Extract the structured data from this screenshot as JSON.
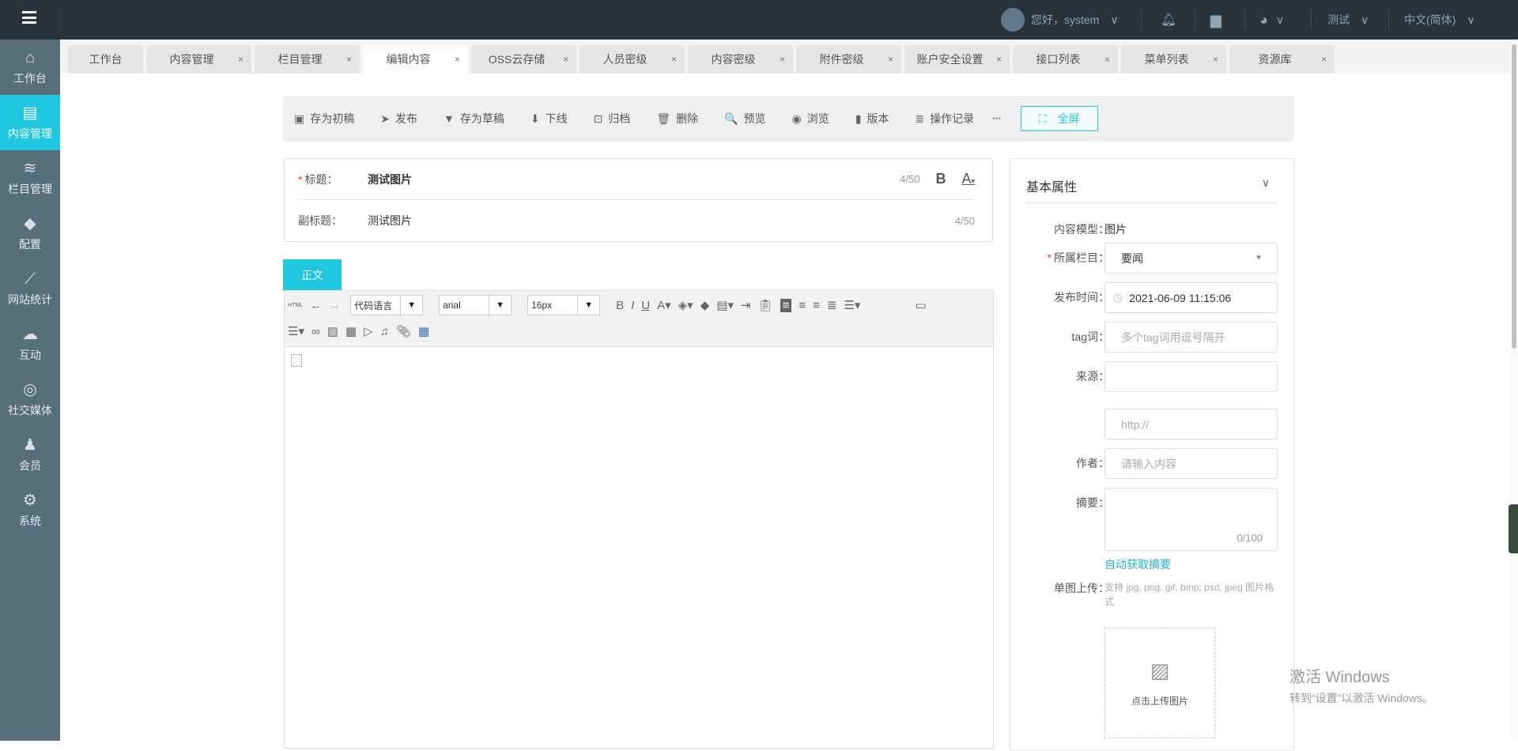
{
  "topbar": {
    "greeting": "您好，system",
    "site": "测试",
    "language": "中文(简体)"
  },
  "sidebar": [
    {
      "icon": "home-icon",
      "glyph": "⌂",
      "label": "工作台"
    },
    {
      "icon": "content-icon",
      "glyph": "▤",
      "label": "内容管理",
      "active": true
    },
    {
      "icon": "layers-icon",
      "glyph": "≋",
      "label": "栏目管理"
    },
    {
      "icon": "cube-icon",
      "glyph": "◆",
      "label": "配置"
    },
    {
      "icon": "chart-icon",
      "glyph": "⟋",
      "label": "网站统计"
    },
    {
      "icon": "chat-icon",
      "glyph": "☁",
      "label": "互动"
    },
    {
      "icon": "social-icon",
      "glyph": "◎",
      "label": "社交媒体"
    },
    {
      "icon": "member-icon",
      "glyph": "♟",
      "label": "会员"
    },
    {
      "icon": "gear-icon",
      "glyph": "⚙",
      "label": "系统"
    }
  ],
  "tabs": [
    {
      "label": "工作台"
    },
    {
      "label": "内容管理"
    },
    {
      "label": "栏目管理"
    },
    {
      "label": "编辑内容",
      "active": true
    },
    {
      "label": "OSS云存储"
    },
    {
      "label": "人员密级"
    },
    {
      "label": "内容密级"
    },
    {
      "label": "附件密级"
    },
    {
      "label": "账户安全设置"
    },
    {
      "label": "接口列表"
    },
    {
      "label": "菜单列表"
    },
    {
      "label": "资源库"
    }
  ],
  "toolbar": {
    "buttons": [
      {
        "icon": "save-icon",
        "glyph": "▣",
        "label": "存为初稿"
      },
      {
        "icon": "send-icon",
        "glyph": "➤",
        "label": "发布"
      },
      {
        "icon": "draft-icon",
        "glyph": "▼",
        "label": "存为草稿"
      },
      {
        "icon": "arrow-down-icon",
        "glyph": "⬇",
        "label": "下线"
      },
      {
        "icon": "archive-icon",
        "glyph": "⊡",
        "label": "归档"
      },
      {
        "icon": "trash-icon",
        "glyph": "🗑",
        "label": "删除"
      },
      {
        "icon": "preview-icon",
        "glyph": "🔍",
        "label": "预览"
      },
      {
        "icon": "eye-icon",
        "glyph": "◉",
        "label": "浏览"
      },
      {
        "icon": "book-icon",
        "glyph": "▮",
        "label": "版本"
      },
      {
        "icon": "history-icon",
        "glyph": "≣",
        "label": "操作记录"
      }
    ],
    "more": "•••",
    "fullscreen": "全屏"
  },
  "title": {
    "label": "标题：",
    "value": "测试图片",
    "count": "4/50"
  },
  "subtitle": {
    "label": "副标题：",
    "value": "测试图片",
    "count": "4/50"
  },
  "editor": {
    "tab": "正文",
    "html": "HTML",
    "code_lang": "代码语言",
    "font": "arial",
    "size": "16px"
  },
  "panel": {
    "title": "基本属性",
    "model_label": "内容模型：",
    "model_value": "图片",
    "column_label": "所属栏目：",
    "column_value": "要闻",
    "time_label": "发布时间：",
    "time_value": "2021-06-09 11:15:06",
    "tag_label": "tag词：",
    "tag_placeholder": "多个tag词用逗号隔开",
    "source_label": "来源：",
    "url_placeholder": "http://",
    "author_label": "作者：",
    "author_placeholder": "请输入内容",
    "summary_label": "摘要：",
    "summary_count": "0/100",
    "auto_summary": "自动获取摘要",
    "upload_label": "单图上传：",
    "upload_hint": "支持 jpg, png, gif, bmp, psd, jpeg 图片格式",
    "upload_button": "点击上传图片"
  },
  "watermark": {
    "line1": "激活 Windows",
    "line2": "转到“设置”以激活 Windows。"
  }
}
